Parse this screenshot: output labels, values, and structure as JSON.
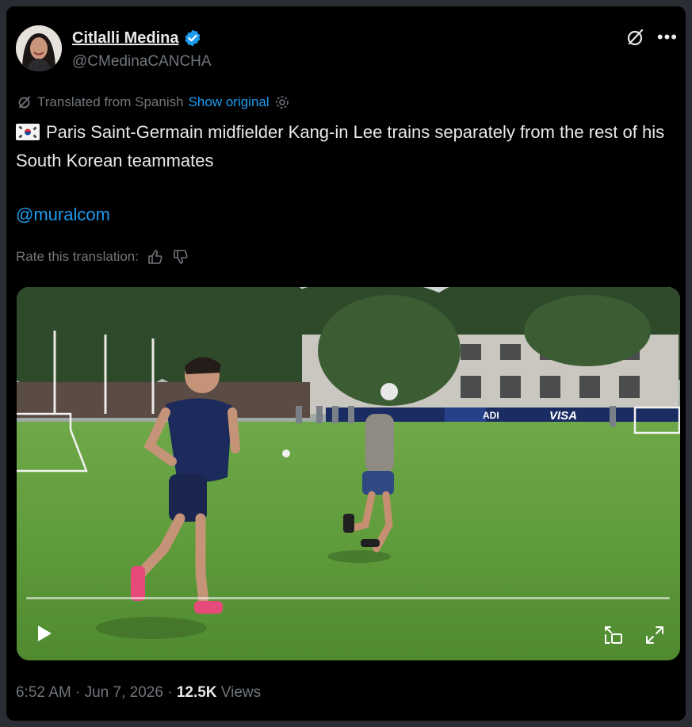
{
  "user": {
    "display_name": "Citlalli Medina",
    "handle": "@CMedinaCANCHA",
    "verified": true
  },
  "translation": {
    "label": "Translated from Spanish",
    "show_original": "Show original",
    "rate_label": "Rate this translation:"
  },
  "tweet": {
    "flag_icon": "south-korea-flag",
    "text": "Paris Saint-Germain midfielder Kang-in Lee trains separately from the rest of his South Korean teammates",
    "mention": "@muralcom"
  },
  "media": {
    "ad_boards": [
      "ADI",
      "VISA"
    ]
  },
  "meta": {
    "time": "6:52 AM",
    "separator": "·",
    "date": "Jun 7, 2026",
    "views_count": "12.5K",
    "views_label": "Views"
  },
  "colors": {
    "accent": "#1d9bf0",
    "background": "#000000",
    "muted": "#71767b",
    "text": "#e7e9ea"
  }
}
